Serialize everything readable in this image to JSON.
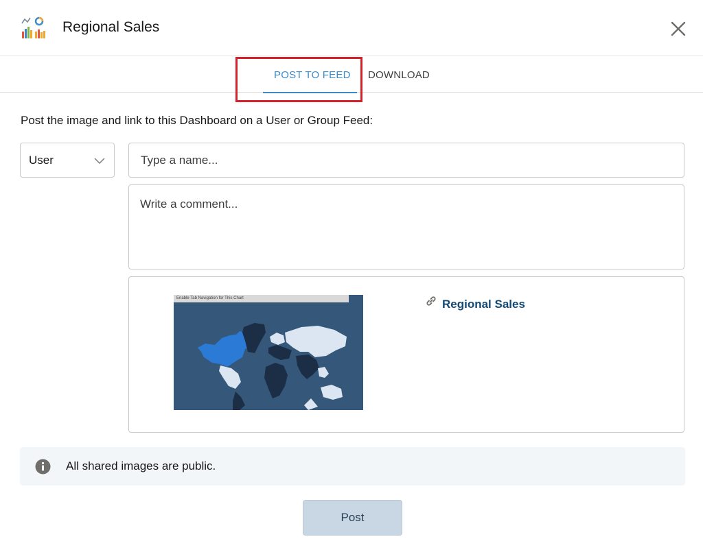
{
  "header": {
    "title": "Regional Sales",
    "app_icon": "dashboard-chart-icon",
    "close_icon": "close-icon"
  },
  "tabs": [
    {
      "label": "POST TO FEED",
      "active": true
    },
    {
      "label": "DOWNLOAD",
      "active": false
    }
  ],
  "form": {
    "instruction": "Post the image and link to this Dashboard on a User or Group Feed:",
    "feed_type": {
      "value": "User"
    },
    "name_input": {
      "value": "",
      "placeholder": "Type a name..."
    },
    "comment": {
      "value": "",
      "placeholder": "Write a comment..."
    }
  },
  "preview": {
    "thumbnail_banner": "Enable Tab Navigation for This Chart",
    "link_label": "Regional Sales",
    "link_icon": "link-icon"
  },
  "notice": {
    "text": "All shared images are public.",
    "icon": "info-icon"
  },
  "actions": {
    "post_label": "Post"
  },
  "colors": {
    "accent": "#3d8ac4",
    "link": "#124a75",
    "highlight_border": "#d2232a",
    "post_button_bg": "#c9d7e4",
    "notice_bg": "#f3f6f9"
  }
}
